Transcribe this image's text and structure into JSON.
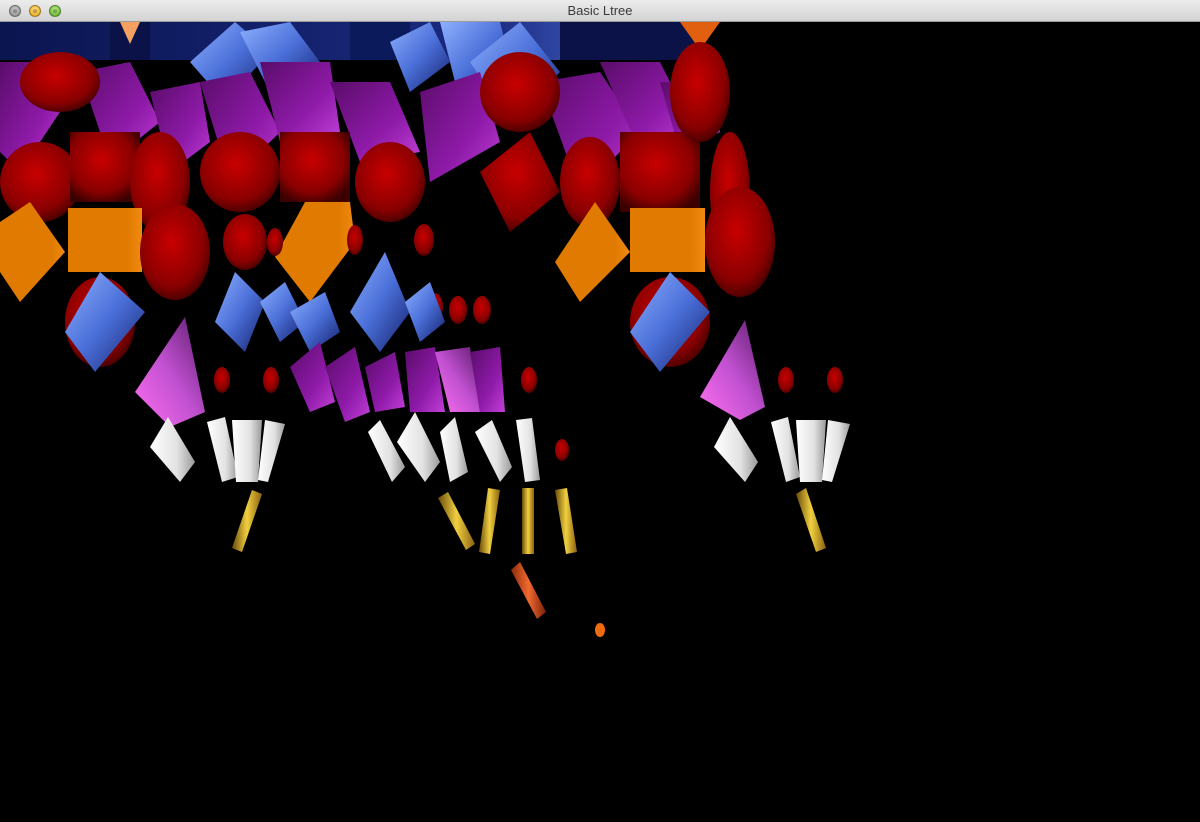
{
  "window": {
    "title": "Basic Ltree"
  },
  "buttons": {
    "close": "close-button",
    "minimize": "minimize-button",
    "zoom": "zoom-button"
  },
  "colors": {
    "background": "#000000",
    "navy": "#0b1a5a",
    "blue": "#5b86f0",
    "purple": "#8b1aa0",
    "magenta": "#d56ee0",
    "red": "#b40000",
    "darkred": "#5a0000",
    "orange": "#e07800",
    "white": "#f0f0f0",
    "gold": "#c89a20"
  }
}
